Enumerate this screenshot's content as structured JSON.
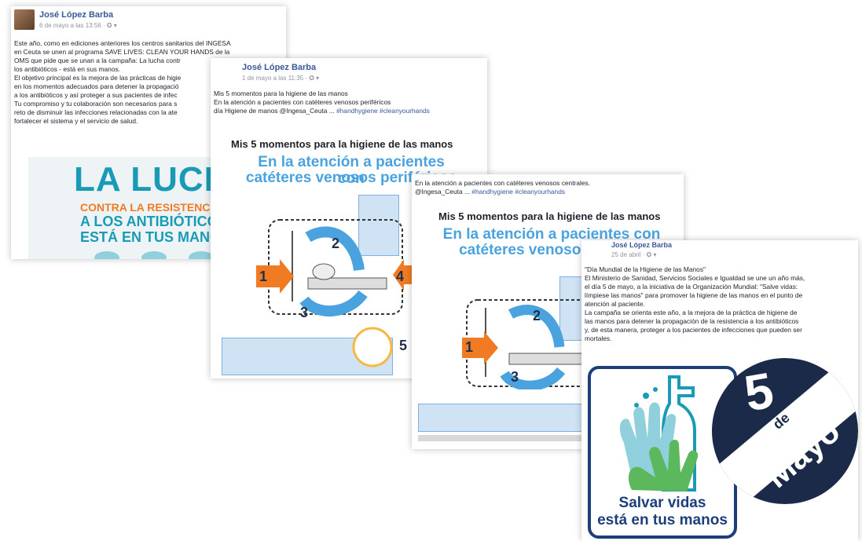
{
  "post1": {
    "author": "José López Barba",
    "meta": "6 de mayo a las 13:56 · ✪ ▾",
    "lines": [
      "Este año, como en ediciones anteriores los centros sanitarios del INGESA",
      "en Ceuta se unen al programa SAVE LIVES: CLEAN YOUR HANDS de la",
      "OMS que pide que se unan a la campaña: La lucha contr",
      "los antibióticos - está en sus manos.",
      "El objetivo principal es la mejora de las prácticas de higie",
      "en los momentos adecuados para detener la propagació",
      "a los antibióticos y así proteger a sus pacientes de infec",
      "Tu compromiso y tu colaboración son necesarios para s",
      "reto de disminuir las infecciones relacionadas con la ate",
      "fortalecer el sistema y el servicio de salud."
    ],
    "banner": {
      "big": "LA LUCHA",
      "l1": "CONTRA LA RESISTENCIA",
      "l2": "A LOS ANTIBIÓTICOS",
      "l3": "ESTÁ EN TUS MANOS"
    }
  },
  "post2": {
    "author": "José López Barba",
    "meta": "1 de mayo a las 11:35 · ✪ ▾",
    "line1": "Mis 5 momentos para la higiene de las manos",
    "line2": "En la atención a pacientes con catéteres venosos periféricos",
    "line3_text": "día Higiene de manos @Ingesa_Ceuta ... ",
    "line3_tags": "#handhygiene #cleanyourhands",
    "poster_title": "Mis 5 momentos para la higiene de las manos",
    "poster_sub1": "En la atención a pacientes con",
    "poster_sub2": "catéteres venosos periféricos"
  },
  "post3": {
    "line1": "En la atención a pacientes con catéteres venosos centrales.",
    "line2_text": "@Ingesa_Ceuta ... ",
    "line2_tags": "#handhygiene #cleanyourhands",
    "poster_title": "Mis 5 momentos para la higiene de las manos",
    "poster_sub1": "En la atención a pacientes con",
    "poster_sub2": "catéteres venosos"
  },
  "post4": {
    "author": "José López Barba",
    "meta": "25 de abril · ✪ ▾",
    "lines": [
      "\"Día Mundial de la Higiene de las Manos\"",
      "El Ministerio de Sanidad, Servicios Sociales e Igualdad se une un año más,",
      "el día 5 de mayo, a la iniciativa de la Organización Mundial: \"Salve vidas:",
      "límpiese las manos\" para promover la higiene de las manos en el punto de",
      "atención al paciente.",
      "La campaña se orienta este año, a la mejora de la práctica de higiene de",
      "las manos para detener la propagación de la resistencia a los antibióticos",
      "y, de esta manera, proteger a los pacientes de infecciones que pueden ser",
      "mortales."
    ],
    "logo_l1": "Salvar vidas",
    "logo_l2": "está en tus manos",
    "badge_num": "5",
    "badge_de": "de",
    "badge_month": "Mayo"
  },
  "colors": {
    "facebook_blue": "#3b5998",
    "poster_blue": "#4aa3df",
    "arrow_orange": "#f07b22",
    "badge_navy": "#1c2a4a",
    "logo_green": "#5cb85c"
  }
}
